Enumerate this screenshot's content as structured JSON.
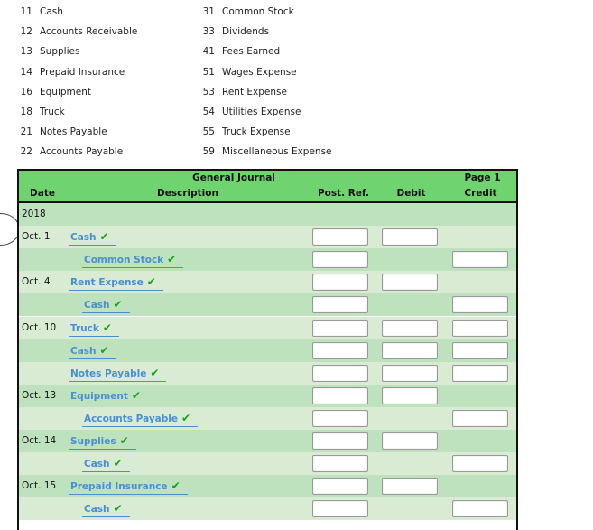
{
  "chart_of_accounts": {
    "left": [
      {
        "number": "11",
        "name": "Cash"
      },
      {
        "number": "12",
        "name": "Accounts Receivable"
      },
      {
        "number": "13",
        "name": "Supplies"
      },
      {
        "number": "14",
        "name": "Prepaid Insurance"
      },
      {
        "number": "16",
        "name": "Equipment"
      },
      {
        "number": "18",
        "name": "Truck"
      },
      {
        "number": "21",
        "name": "Notes Payable"
      },
      {
        "number": "22",
        "name": "Accounts Payable"
      }
    ],
    "right": [
      {
        "number": "31",
        "name": "Common Stock"
      },
      {
        "number": "33",
        "name": "Dividends"
      },
      {
        "number": "41",
        "name": "Fees Earned"
      },
      {
        "number": "51",
        "name": "Wages Expense"
      },
      {
        "number": "53",
        "name": "Rent Expense"
      },
      {
        "number": "54",
        "name": "Utilities Expense"
      },
      {
        "number": "55",
        "name": "Truck Expense"
      },
      {
        "number": "59",
        "name": "Miscellaneous Expense"
      }
    ]
  },
  "journal": {
    "title": "General Journal",
    "page": "Page 1",
    "columns": {
      "date": "Date",
      "description": "Description",
      "post_ref": "Post. Ref.",
      "debit": "Debit",
      "credit": "Credit"
    },
    "check_mark": "✔",
    "colors": {
      "header": "#6fd46f",
      "row_dark": "#bde2bd",
      "row_light": "#d9ebd3",
      "link": "#4a8fd1",
      "check": "#1aa01a"
    },
    "rows": [
      {
        "date": "2018",
        "account": "",
        "indent": false,
        "post_ref": null,
        "debit": null,
        "credit": null
      },
      {
        "date": "Oct. 1",
        "account": "Cash",
        "indent": false,
        "post_ref": "",
        "debit": "",
        "credit": null
      },
      {
        "date": "",
        "account": "Common Stock",
        "indent": true,
        "post_ref": "",
        "debit": null,
        "credit": ""
      },
      {
        "date": "Oct. 4",
        "account": "Rent Expense",
        "indent": false,
        "post_ref": "",
        "debit": "",
        "credit": null
      },
      {
        "date": "",
        "account": "Cash",
        "indent": true,
        "post_ref": "",
        "debit": null,
        "credit": ""
      },
      {
        "date": "Oct. 10",
        "account": "Truck",
        "indent": false,
        "post_ref": "",
        "debit": "",
        "credit": ""
      },
      {
        "date": "",
        "account": "Cash",
        "indent": false,
        "post_ref": "",
        "debit": "",
        "credit": ""
      },
      {
        "date": "",
        "account": "Notes Payable",
        "indent": false,
        "post_ref": "",
        "debit": "",
        "credit": ""
      },
      {
        "date": "Oct. 13",
        "account": "Equipment",
        "indent": false,
        "post_ref": "",
        "debit": "",
        "credit": null
      },
      {
        "date": "",
        "account": "Accounts Payable",
        "indent": true,
        "post_ref": "",
        "debit": null,
        "credit": ""
      },
      {
        "date": "Oct. 14",
        "account": "Supplies",
        "indent": false,
        "post_ref": "",
        "debit": "",
        "credit": null
      },
      {
        "date": "",
        "account": "Cash",
        "indent": true,
        "post_ref": "",
        "debit": null,
        "credit": ""
      },
      {
        "date": "Oct. 15",
        "account": "Prepaid Insurance",
        "indent": false,
        "post_ref": "",
        "debit": "",
        "credit": null
      },
      {
        "date": "",
        "account": "Cash",
        "indent": true,
        "post_ref": "",
        "debit": null,
        "credit": ""
      }
    ]
  }
}
